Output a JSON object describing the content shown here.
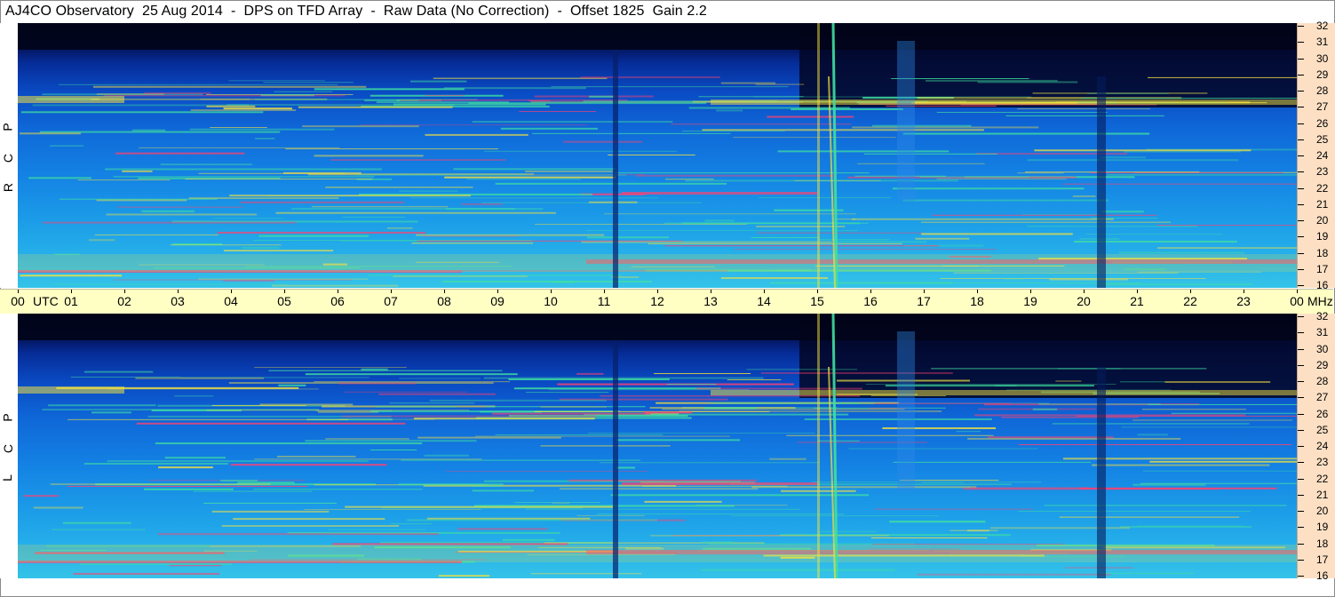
{
  "title": "AJ4CO Observatory  25 Aug 2014  -  DPS on TFD Array  -  Raw Data (No Correction)  -  Offset 1825  Gain 2.2",
  "panels": [
    {
      "polarization_letters": [
        "R",
        "C",
        "P"
      ]
    },
    {
      "polarization_letters": [
        "L",
        "C",
        "P"
      ]
    }
  ],
  "time_axis": {
    "labels": [
      "00",
      "01",
      "02",
      "03",
      "04",
      "05",
      "06",
      "07",
      "08",
      "09",
      "10",
      "11",
      "12",
      "13",
      "14",
      "15",
      "16",
      "17",
      "18",
      "19",
      "20",
      "21",
      "22",
      "23",
      "00"
    ],
    "unit_left": "UTC",
    "unit_right": "MHz"
  },
  "freq_axis": {
    "labels": [
      "32",
      "31",
      "30",
      "29",
      "28",
      "27",
      "26",
      "25",
      "24",
      "23",
      "22",
      "21",
      "20",
      "19",
      "18",
      "17",
      "16"
    ]
  },
  "colors": {
    "background_top": "#03071c",
    "background_mid": "#0f68d8",
    "background_bottom": "#35c3e8",
    "freq_axis_bg": "#fde0c4",
    "time_axis_bg": "#ffffc4",
    "emission_hot": "#ff4070",
    "emission_warm": "#f2e040",
    "emission_cool": "#40e0a0"
  }
}
